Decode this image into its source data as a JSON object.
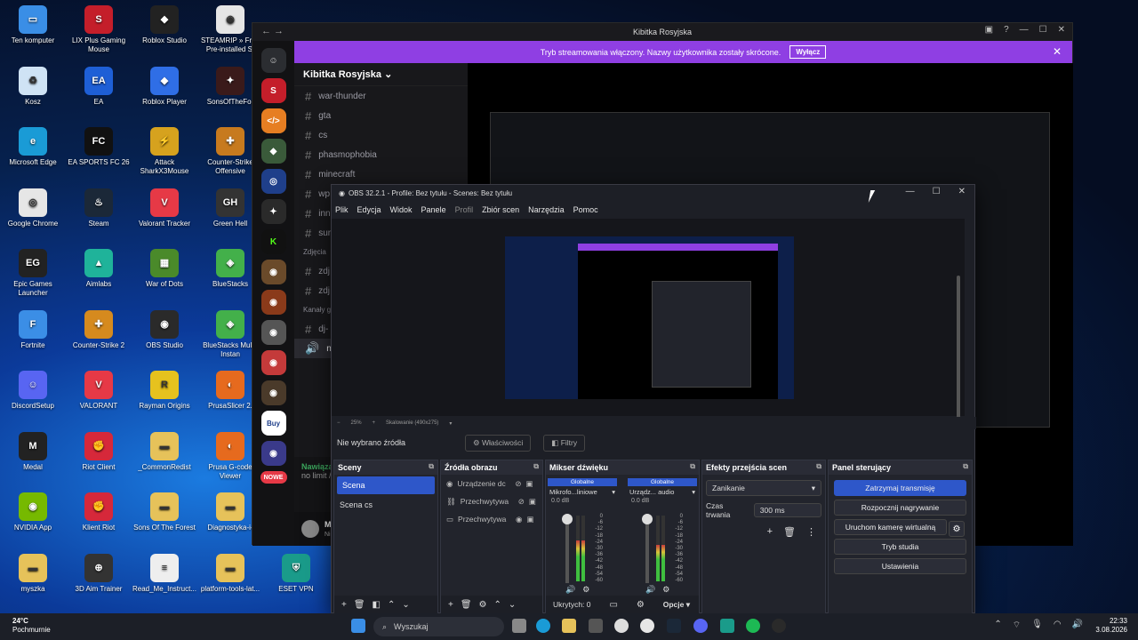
{
  "desktop": {
    "icons": [
      {
        "label": "Ten komputer",
        "col": 0,
        "row": 0,
        "color": "#3a8ee6",
        "glyph": "▭"
      },
      {
        "label": "LIX Plus Gaming Mouse",
        "col": 1,
        "row": 0,
        "color": "#c41e2a",
        "glyph": "S"
      },
      {
        "label": "Roblox Studio",
        "col": 2,
        "row": 0,
        "color": "#222",
        "glyph": "◆"
      },
      {
        "label": "STEAMRIP » Free Pre-installed St",
        "col": 3,
        "row": 0,
        "color": "#e6e6e6",
        "glyph": "◉"
      },
      {
        "label": "Kosz",
        "col": 0,
        "row": 1,
        "color": "#cfe3f5",
        "glyph": "♻"
      },
      {
        "label": "EA",
        "col": 1,
        "row": 1,
        "color": "#1e5fd6",
        "glyph": "EA"
      },
      {
        "label": "Roblox Player",
        "col": 2,
        "row": 1,
        "color": "#2f6ee6",
        "glyph": "◆"
      },
      {
        "label": "SonsOfTheFor",
        "col": 3,
        "row": 1,
        "color": "#3a1a1a",
        "glyph": "✦"
      },
      {
        "label": "Microsoft Edge",
        "col": 0,
        "row": 2,
        "color": "#1a9bd6",
        "glyph": "e"
      },
      {
        "label": "EA SPORTS FC 26",
        "col": 1,
        "row": 2,
        "color": "#111",
        "glyph": "FC"
      },
      {
        "label": "Attack SharkX3Mouse",
        "col": 2,
        "row": 2,
        "color": "#d6a21e",
        "glyph": "⚡"
      },
      {
        "label": "Counter-Strike Offensive",
        "col": 3,
        "row": 2,
        "color": "#c77a1e",
        "glyph": "✚"
      },
      {
        "label": "Google Chrome",
        "col": 0,
        "row": 3,
        "color": "#e6e6e6",
        "glyph": "◎"
      },
      {
        "label": "Steam",
        "col": 1,
        "row": 3,
        "color": "#1b2838",
        "glyph": "♨"
      },
      {
        "label": "Valorant Tracker",
        "col": 2,
        "row": 3,
        "color": "#e63946",
        "glyph": "V"
      },
      {
        "label": "Green Hell",
        "col": 3,
        "row": 3,
        "color": "#333",
        "glyph": "GH"
      },
      {
        "label": "Epic Games Launcher",
        "col": 0,
        "row": 4,
        "color": "#222",
        "glyph": "EG"
      },
      {
        "label": "Aimlabs",
        "col": 1,
        "row": 4,
        "color": "#1fb39a",
        "glyph": "▲"
      },
      {
        "label": "War of Dots",
        "col": 2,
        "row": 4,
        "color": "#4a8a2a",
        "glyph": "▦"
      },
      {
        "label": "BlueStacks",
        "col": 3,
        "row": 4,
        "color": "#43b04a",
        "glyph": "◈"
      },
      {
        "label": "Fortnite",
        "col": 0,
        "row": 5,
        "color": "#3b8ee6",
        "glyph": "F"
      },
      {
        "label": "Counter-Strike 2",
        "col": 1,
        "row": 5,
        "color": "#d68a1e",
        "glyph": "✚"
      },
      {
        "label": "OBS Studio",
        "col": 2,
        "row": 5,
        "color": "#2a2a2a",
        "glyph": "◉"
      },
      {
        "label": "BlueStacks Multi-Instan",
        "col": 3,
        "row": 5,
        "color": "#43b04a",
        "glyph": "◈"
      },
      {
        "label": "DiscordSetup",
        "col": 0,
        "row": 6,
        "color": "#5865f2",
        "glyph": "☺"
      },
      {
        "label": "VALORANT",
        "col": 1,
        "row": 6,
        "color": "#e63946",
        "glyph": "V"
      },
      {
        "label": "Rayman Origins",
        "col": 2,
        "row": 6,
        "color": "#e6c21e",
        "glyph": "R"
      },
      {
        "label": "PrusaSlicer 2.",
        "col": 3,
        "row": 6,
        "color": "#e66a1e",
        "glyph": "◐"
      },
      {
        "label": "Medal",
        "col": 0,
        "row": 7,
        "color": "#222",
        "glyph": "M"
      },
      {
        "label": "Riot Client",
        "col": 1,
        "row": 7,
        "color": "#d6283a",
        "glyph": "✊"
      },
      {
        "label": "_CommonRedist",
        "col": 2,
        "row": 7,
        "color": "#e6c25a",
        "glyph": "▬"
      },
      {
        "label": "Prusa G-code Viewer",
        "col": 3,
        "row": 7,
        "color": "#e66a1e",
        "glyph": "◐"
      },
      {
        "label": "NVIDIA App",
        "col": 0,
        "row": 8,
        "color": "#76b900",
        "glyph": "◉"
      },
      {
        "label": "Klient Riot",
        "col": 1,
        "row": 8,
        "color": "#d6283a",
        "glyph": "✊"
      },
      {
        "label": "Sons Of The Forest",
        "col": 2,
        "row": 8,
        "color": "#e6c25a",
        "glyph": "▬"
      },
      {
        "label": "Diagnostyka-i-",
        "col": 3,
        "row": 8,
        "color": "#e6c25a",
        "glyph": "▬"
      },
      {
        "label": "myszka",
        "col": 0,
        "row": 9,
        "color": "#e6c25a",
        "glyph": "▬"
      },
      {
        "label": "3D Aim Trainer",
        "col": 1,
        "row": 9,
        "color": "#333",
        "glyph": "⊕"
      },
      {
        "label": "Read_Me_Instruct...",
        "col": 2,
        "row": 9,
        "color": "#eee",
        "glyph": "≡"
      },
      {
        "label": "platform-tools-lat...",
        "col": 3,
        "row": 9,
        "color": "#e6c25a",
        "glyph": "▬"
      },
      {
        "label": "ESET VPN",
        "col": 4,
        "row": 9,
        "color": "#1a9b8a",
        "glyph": "⛨"
      }
    ]
  },
  "discord": {
    "window_title": "Kibitka Rosyjska",
    "banner_text": "Tryb streamowania włączony. Nazwy użytkownika zostały skrócone.",
    "banner_button": "Wyłącz",
    "guild_name": "Kibitka Rosyjska",
    "channels": [
      "war-thunder",
      "gta",
      "cs",
      "phasmophobia",
      "minecraft",
      "wp",
      "inn",
      "sur"
    ],
    "category_photos": "Zdjęcia",
    "photo_channels": [
      "zdj",
      "zdj"
    ],
    "category_voice": "Kanały g",
    "voice_channels": [
      "dj-"
    ],
    "active_voice": "no",
    "active_voice_sub": "Ust",
    "voice_status": "Nawiązano",
    "voice_sub": "no limit / Kibit",
    "user_name": "M...",
    "user_status": "Niewidoczny",
    "new_badge": "NOWE"
  },
  "obs": {
    "title": "OBS 32.2.1 - Profile: Bez tytułu - Scenes: Bez tytułu",
    "menu": [
      "Plik",
      "Edycja",
      "Widok",
      "Panele",
      "Profil",
      "Zbiór scen",
      "Narzędzia",
      "Pomoc"
    ],
    "menu_disabled_index": 4,
    "zoom_text": "25%",
    "scale_text": "Skalowanie (490x275)",
    "no_source": "Nie wybrano źródła",
    "properties": "Właściwości",
    "filters": "Filtry",
    "scenes_title": "Sceny",
    "scenes": [
      "Scena",
      "Scena cs"
    ],
    "sources_title": "Źródła obrazu",
    "sources": [
      "Urządzenie dc",
      "Przechwytywa",
      "Przechwytywa"
    ],
    "mixer_title": "Mikser dźwięku",
    "mixer": [
      {
        "global": "Globalne",
        "name": "Mikrofo...liniowe",
        "db": "0.0 dB",
        "level": 0.62
      },
      {
        "global": "Globalne",
        "name": "Urządz... audio",
        "db": "0.0 dB",
        "level": 0.55
      }
    ],
    "mixer_scale": [
      "0",
      "-6",
      "-12",
      "-18",
      "-24",
      "-30",
      "-36",
      "-42",
      "-48",
      "-54",
      "-60"
    ],
    "hidden_label": "Ukrytych: 0",
    "options_label": "Opcje",
    "transitions_title": "Efekty przejścia scen",
    "transition": "Zanikanie",
    "duration_label": "Czas trwania",
    "duration_value": "300 ms",
    "controls_title": "Panel sterujący",
    "controls": [
      "Zatrzymaj transmisję",
      "Rozpocznij nagrywanie",
      "Uruchom kamerę wirtualną",
      "Tryb studia",
      "Ustawienia"
    ]
  },
  "taskbar": {
    "temp": "24°C",
    "weather": "Pochmurnie",
    "search": "Wyszukaj",
    "time": "22:33",
    "date": "3.08.2026"
  }
}
